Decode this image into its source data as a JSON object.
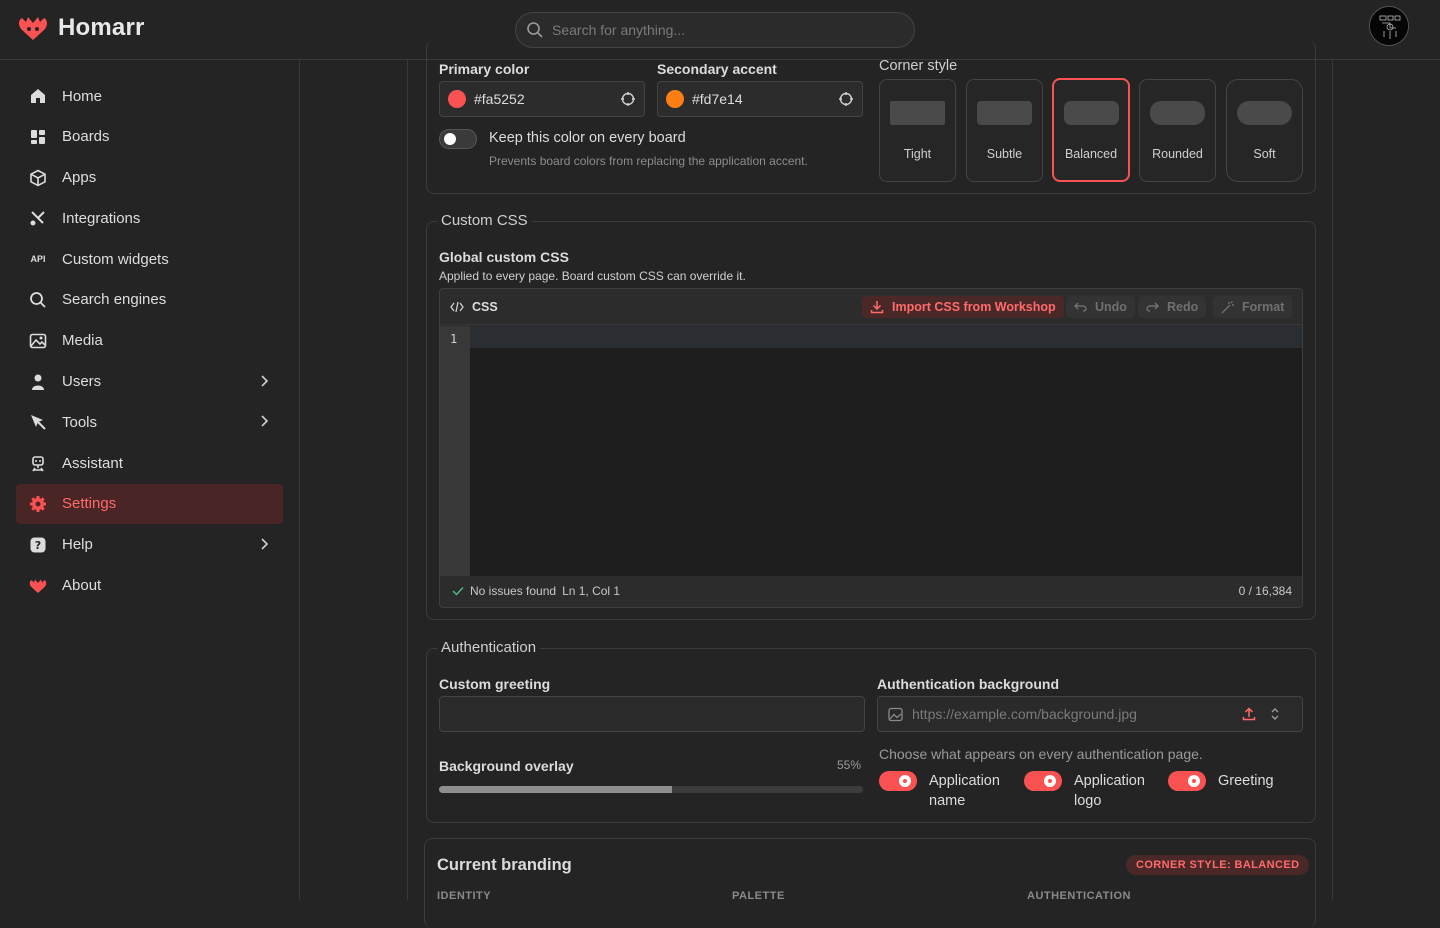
{
  "app": {
    "name": "Homarr"
  },
  "search": {
    "placeholder": "Search for anything..."
  },
  "sidebar": {
    "items": [
      {
        "label": "Home",
        "icon": "home-icon"
      },
      {
        "label": "Boards",
        "icon": "boards-icon"
      },
      {
        "label": "Apps",
        "icon": "apps-icon"
      },
      {
        "label": "Integrations",
        "icon": "integrations-icon"
      },
      {
        "label": "Custom widgets",
        "icon": "api-icon"
      },
      {
        "label": "Search engines",
        "icon": "search-icon"
      },
      {
        "label": "Media",
        "icon": "media-icon"
      },
      {
        "label": "Users",
        "icon": "users-icon"
      },
      {
        "label": "Tools",
        "icon": "tools-icon"
      },
      {
        "label": "Assistant",
        "icon": "assistant-icon"
      },
      {
        "label": "Settings",
        "icon": "gear-icon"
      },
      {
        "label": "Help",
        "icon": "help-icon"
      },
      {
        "label": "About",
        "icon": "logo-icon"
      }
    ],
    "api_glyph": "API"
  },
  "appearance": {
    "primary_label": "Primary color",
    "primary_value": "#fa5252",
    "secondary_label": "Secondary accent",
    "secondary_value": "#fd7e14",
    "keep_label": "Keep this color on every board",
    "keep_hint": "Prevents board colors from replacing the application accent.",
    "corner_label": "Corner style",
    "corners": [
      "Tight",
      "Subtle",
      "Balanced",
      "Rounded",
      "Soft"
    ],
    "selected_corner": "Balanced"
  },
  "custom_css": {
    "legend": "Custom CSS",
    "title": "Global custom CSS",
    "hint": "Applied to every page. Board custom CSS can override it.",
    "lang": "CSS",
    "import_label": "Import CSS from Workshop",
    "undo_label": "Undo",
    "redo_label": "Redo",
    "format_label": "Format",
    "line_number": "1",
    "status": "No issues found",
    "position": "Ln 1, Col 1",
    "count": "0 / 16,384"
  },
  "authentication": {
    "legend": "Authentication",
    "greeting_label": "Custom greeting",
    "background_label": "Authentication background",
    "background_placeholder": "https://example.com/background.jpg",
    "overlay_label": "Background overlay",
    "overlay_value": "55%",
    "overlay_fraction": 0.55,
    "choose_hint": "Choose what appears on every authentication page.",
    "toggles": [
      {
        "line1": "Application",
        "line2": "name"
      },
      {
        "line1": "Application",
        "line2": "logo"
      },
      {
        "line1": "Greeting",
        "line2": ""
      }
    ]
  },
  "branding": {
    "title": "Current branding",
    "badge": "CORNER STYLE: BALANCED",
    "columns": [
      "IDENTITY",
      "PALETTE",
      "AUTHENTICATION"
    ]
  },
  "colors": {
    "accent": "#fa5252",
    "secondary": "#fd7e14"
  }
}
